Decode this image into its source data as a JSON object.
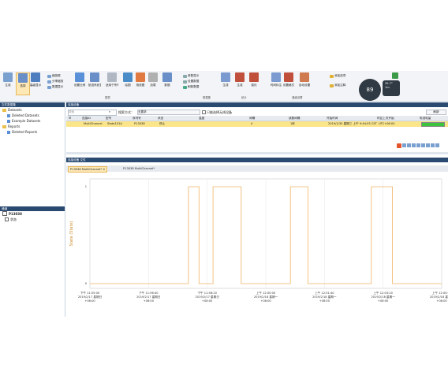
{
  "ribbon": {
    "buttons": [
      {
        "label": "生成"
      },
      {
        "label": "选择"
      },
      {
        "label": "高级显示"
      },
      {
        "label": "设置比例"
      },
      {
        "label": "航迹系统显示"
      },
      {
        "label": "适用于所有通道"
      },
      {
        "label": "绘图"
      },
      {
        "label": "拖放图"
      },
      {
        "label": "加载"
      },
      {
        "label": "数据"
      },
      {
        "label": "生成"
      },
      {
        "label": "生成"
      },
      {
        "label": "强化"
      },
      {
        "label": "时间标注"
      },
      {
        "label": "设置格式"
      },
      {
        "label": "自动设置"
      }
    ],
    "small_items": [
      "缩放框",
      "分率缩放",
      "数据显示",
      "参数显示",
      "设置数据",
      "刷新数据",
      "添加选项",
      "添加注释"
    ],
    "groups": [
      "图表",
      "数据集",
      "统计",
      "通道设置"
    ],
    "gauge_value": "89",
    "gauge_sub": [
      "35.7°",
      "1m"
    ]
  },
  "left": {
    "header": "文件数据集",
    "tree": [
      {
        "label": "Datasets",
        "kind": "folder"
      },
      {
        "label": "Deleted Datasets",
        "kind": "item"
      },
      {
        "label": "Example Datasets",
        "kind": "item"
      },
      {
        "label": "Reports",
        "kind": "folder"
      },
      {
        "label": "Deleted Reports",
        "kind": "item"
      }
    ]
  },
  "channels": {
    "header": "通道",
    "device": "P13038",
    "item": "状态"
  },
  "devices": {
    "header": "连接设备",
    "search_placeholder": "搜索",
    "search_mode_label": "搜索方式：",
    "search_mode_value": "无要求",
    "wireless_only": "只能选择无线设备",
    "refresh_button": "刷新",
    "columns": [
      "连接ID",
      "型号",
      "序列号",
      "状态",
      "温度",
      "间隔",
      "读数间隔",
      "开始时间",
      "时区上次开始",
      "电池电量"
    ],
    "rows": [
      [
        "MultiChannel",
        "State101A",
        "P13038",
        "停止",
        "",
        "4",
        "1秒",
        "2019/1/30 星期三 上午 9:44:03 CST",
        "UTC+08:00",
        ""
      ]
    ]
  },
  "panel": {
    "header": "连接设备  文件",
    "tabs": [
      {
        "label": "P13038 MultiChannel*"
      },
      {
        "label": "P13038 MultiChannel*"
      }
    ]
  },
  "chart_data": {
    "type": "line",
    "ylabel": "State (State)",
    "x_ticks": [
      {
        "t": "下午 11:55:00",
        "d": "2019/2/17 星期日",
        "z": "+08:00"
      },
      {
        "t": "下午 11:56:40",
        "d": "2019/2/17 星期日",
        "z": "+08:00"
      },
      {
        "t": "下午 11:58:20",
        "d": "2019/2/17 星期日",
        "z": "+08:00"
      },
      {
        "t": "上午 12:00:00",
        "d": "2019/2/18 星期一",
        "z": "+08:00"
      },
      {
        "t": "上午 12:01:40",
        "d": "2019/2/18 星期一",
        "z": "+08:00"
      },
      {
        "t": "上午 12:03:20",
        "d": "2019/2/18 星期一",
        "z": "+08:00"
      },
      {
        "t": "上午 12:05:00",
        "d": "2019/2/18 星期一",
        "z": "+08:00"
      }
    ],
    "y_ticks": [
      "1",
      "0"
    ],
    "state_segments": [
      [
        0.0,
        0
      ],
      [
        0.28,
        0
      ],
      [
        0.28,
        1
      ],
      [
        0.31,
        1
      ],
      [
        0.31,
        0
      ],
      [
        0.35,
        0
      ],
      [
        0.35,
        1
      ],
      [
        0.43,
        1
      ],
      [
        0.43,
        0
      ],
      [
        0.57,
        0
      ],
      [
        0.57,
        1
      ],
      [
        0.62,
        1
      ],
      [
        0.62,
        0
      ],
      [
        0.8,
        0
      ],
      [
        0.8,
        1
      ],
      [
        0.86,
        1
      ],
      [
        0.86,
        0
      ],
      [
        1.0,
        0
      ]
    ],
    "line_color": "#f0b365"
  }
}
